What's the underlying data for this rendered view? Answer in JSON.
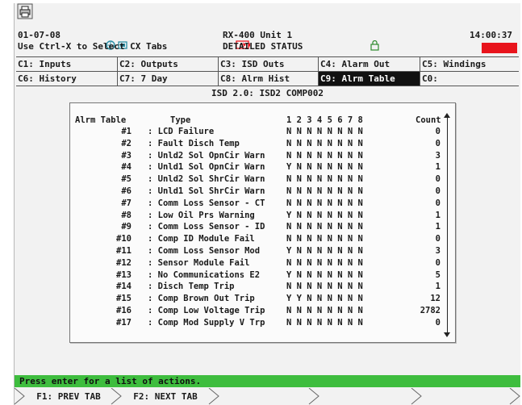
{
  "header": {
    "date": "01-07-08",
    "hint": "Use Ctrl-X to Select CX Tabs",
    "unit": "RX-400 Unit 1",
    "view": "DETAILED STATUS",
    "time": "14:00:37"
  },
  "tabs": [
    [
      "C1: Inputs",
      "C2: Outputs",
      "C3: ISD Outs",
      "C4: Alarm Out",
      "C5: Windings"
    ],
    [
      "C6: History",
      "C7: 7 Day",
      "C8: Alrm Hist",
      "C9: Alrm Table",
      "C0:"
    ]
  ],
  "active_tab": "C9: Alrm Table",
  "subtitle": "ISD 2.0: ISD2 COMP002",
  "alarm_table": {
    "headers": {
      "label": "Alrm Table",
      "type": "Type",
      "bits": "1 2 3 4 5 6 7 8",
      "count": "Count"
    },
    "rows": [
      {
        "num": "#1",
        "type": ": LCD Failure",
        "bits": "N N N N N N N N",
        "count": "0"
      },
      {
        "num": "#2",
        "type": ": Fault Disch Temp",
        "bits": "N N N N N N N N",
        "count": "0"
      },
      {
        "num": "#3",
        "type": ": Unld2 Sol OpnCir Warn",
        "bits": "N N N N N N N N",
        "count": "3"
      },
      {
        "num": "#4",
        "type": ": Unld1 Sol OpnCir Warn",
        "bits": "Y N N N N N N N",
        "count": "1"
      },
      {
        "num": "#5",
        "type": ": Unld2 Sol ShrCir Warn",
        "bits": "N N N N N N N N",
        "count": "0"
      },
      {
        "num": "#6",
        "type": ": Unld1 Sol ShrCir Warn",
        "bits": "N N N N N N N N",
        "count": "0"
      },
      {
        "num": "#7",
        "type": ": Comm Loss Sensor - CT",
        "bits": "N N N N N N N N",
        "count": "0"
      },
      {
        "num": "#8",
        "type": ": Low Oil Prs Warning",
        "bits": "Y N N N N N N N",
        "count": "1"
      },
      {
        "num": "#9",
        "type": ": Comm Loss Sensor - ID",
        "bits": "N N N N N N N N",
        "count": "1"
      },
      {
        "num": "#10",
        "type": ": Comp ID Module Fail",
        "bits": "N N N N N N N N",
        "count": "0"
      },
      {
        "num": "#11",
        "type": ": Comm Loss Sensor Mod",
        "bits": "Y N N N N N N N",
        "count": "3"
      },
      {
        "num": "#12",
        "type": ": Sensor Module Fail",
        "bits": "N N N N N N N N",
        "count": "0"
      },
      {
        "num": "#13",
        "type": ": No Communications E2",
        "bits": "Y N N N N N N N",
        "count": "5"
      },
      {
        "num": "#14",
        "type": ": Disch Temp Trip",
        "bits": "N N N N N N N N",
        "count": "1"
      },
      {
        "num": "#15",
        "type": ": Comp Brown Out Trip",
        "bits": "Y Y N N N N N N",
        "count": "12"
      },
      {
        "num": "#16",
        "type": ": Comp Low Voltage Trip",
        "bits": "N N N N N N N N",
        "count": "2782"
      },
      {
        "num": "#17",
        "type": ": Comp Mod Supply V Trp",
        "bits": "N N N N N N N N",
        "count": "0"
      }
    ]
  },
  "status_bar": "Press enter for a list of actions.",
  "fkeys": [
    "F1: PREV TAB",
    "F2: NEXT TAB"
  ],
  "icons": [
    "printer-icon",
    "network-icon",
    "monitor-icon",
    "battery-icon",
    "lock-icon"
  ],
  "colors": {
    "alarm": "#e8141c",
    "status_bar": "#3ebd3e",
    "active_tab": "#111111"
  }
}
